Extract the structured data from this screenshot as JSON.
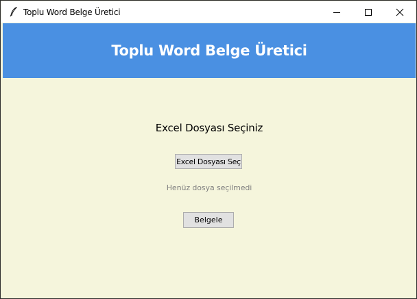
{
  "window": {
    "title": "Toplu Word Belge Üretici",
    "icon": "feather-icon"
  },
  "header": {
    "title": "Toplu Word Belge Üretici",
    "background": "#4a90e2"
  },
  "main": {
    "section_title": "Excel Dosyası Seçiniz",
    "select_button_label": "Excel Dosyası Seç",
    "status_text": "Henüz dosya seçilmedi",
    "generate_button_label": "Belgele",
    "background": "#f5f5dc"
  }
}
